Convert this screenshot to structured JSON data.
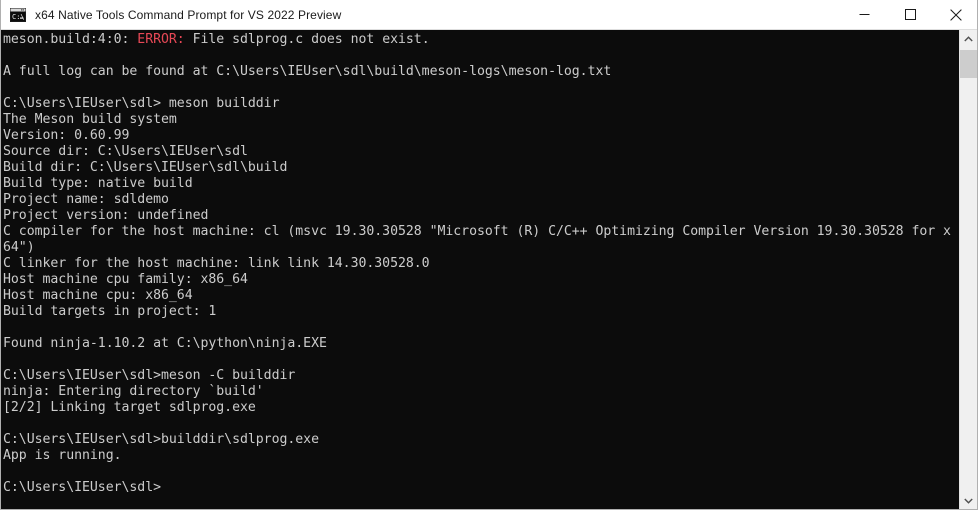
{
  "window": {
    "title": "x64 Native Tools Command Prompt for VS 2022 Preview",
    "icon": "console-app-icon",
    "titlebar_bg": "#ffffff",
    "title_color": "#1a1a1a",
    "controls": [
      {
        "name": "minimize-button",
        "glyph": "minimize-icon",
        "label": "Minimize"
      },
      {
        "name": "maximize-button",
        "glyph": "maximize-icon",
        "label": "Maximize"
      },
      {
        "name": "close-button",
        "glyph": "close-icon",
        "label": "Close"
      }
    ]
  },
  "console": {
    "background": "#0c0c0c",
    "foreground": "#cccccc",
    "error_color": "#e74856",
    "lines": [
      {
        "segments": [
          {
            "text": "meson.build:4:0: "
          },
          {
            "text": "ERROR:",
            "style": "err"
          },
          {
            "text": " File sdlprog.c does not exist."
          }
        ]
      },
      {
        "segments": [
          {
            "text": ""
          }
        ]
      },
      {
        "segments": [
          {
            "text": "A full log can be found at C:\\Users\\IEUser\\sdl\\build\\meson-logs\\meson-log.txt"
          }
        ]
      },
      {
        "segments": [
          {
            "text": ""
          }
        ]
      },
      {
        "segments": [
          {
            "text": "C:\\Users\\IEUser\\sdl> meson builddir"
          }
        ]
      },
      {
        "segments": [
          {
            "text": "The Meson build system"
          }
        ]
      },
      {
        "segments": [
          {
            "text": "Version: 0.60.99"
          }
        ]
      },
      {
        "segments": [
          {
            "text": "Source dir: C:\\Users\\IEUser\\sdl"
          }
        ]
      },
      {
        "segments": [
          {
            "text": "Build dir: C:\\Users\\IEUser\\sdl\\build"
          }
        ]
      },
      {
        "segments": [
          {
            "text": "Build type: native build"
          }
        ]
      },
      {
        "segments": [
          {
            "text": "Project name: sdldemo"
          }
        ]
      },
      {
        "segments": [
          {
            "text": "Project version: undefined"
          }
        ]
      },
      {
        "segments": [
          {
            "text": "C compiler for the host machine: cl (msvc 19.30.30528 \"Microsoft (R) C/C++ Optimizing Compiler Version 19.30.30528 for x"
          }
        ]
      },
      {
        "segments": [
          {
            "text": "64\")"
          }
        ]
      },
      {
        "segments": [
          {
            "text": "C linker for the host machine: link link 14.30.30528.0"
          }
        ]
      },
      {
        "segments": [
          {
            "text": "Host machine cpu family: x86_64"
          }
        ]
      },
      {
        "segments": [
          {
            "text": "Host machine cpu: x86_64"
          }
        ]
      },
      {
        "segments": [
          {
            "text": "Build targets in project: 1"
          }
        ]
      },
      {
        "segments": [
          {
            "text": ""
          }
        ]
      },
      {
        "segments": [
          {
            "text": "Found ninja-1.10.2 at C:\\python\\ninja.EXE"
          }
        ]
      },
      {
        "segments": [
          {
            "text": ""
          }
        ]
      },
      {
        "segments": [
          {
            "text": "C:\\Users\\IEUser\\sdl>meson -C builddir"
          }
        ]
      },
      {
        "segments": [
          {
            "text": "ninja: Entering directory `build'"
          }
        ]
      },
      {
        "segments": [
          {
            "text": "[2/2] Linking target sdlprog.exe"
          }
        ]
      },
      {
        "segments": [
          {
            "text": ""
          }
        ]
      },
      {
        "segments": [
          {
            "text": "C:\\Users\\IEUser\\sdl>builddir\\sdlprog.exe"
          }
        ]
      },
      {
        "segments": [
          {
            "text": "App is running."
          }
        ]
      },
      {
        "segments": [
          {
            "text": ""
          }
        ]
      },
      {
        "segments": [
          {
            "text": "C:\\Users\\IEUser\\sdl>"
          }
        ]
      }
    ]
  },
  "scrollbar": {
    "up_arrow": "chevron-up-icon",
    "down_arrow": "chevron-down-icon",
    "thumb_color": "#cdcdcd",
    "track_color": "#f0f0f0"
  }
}
